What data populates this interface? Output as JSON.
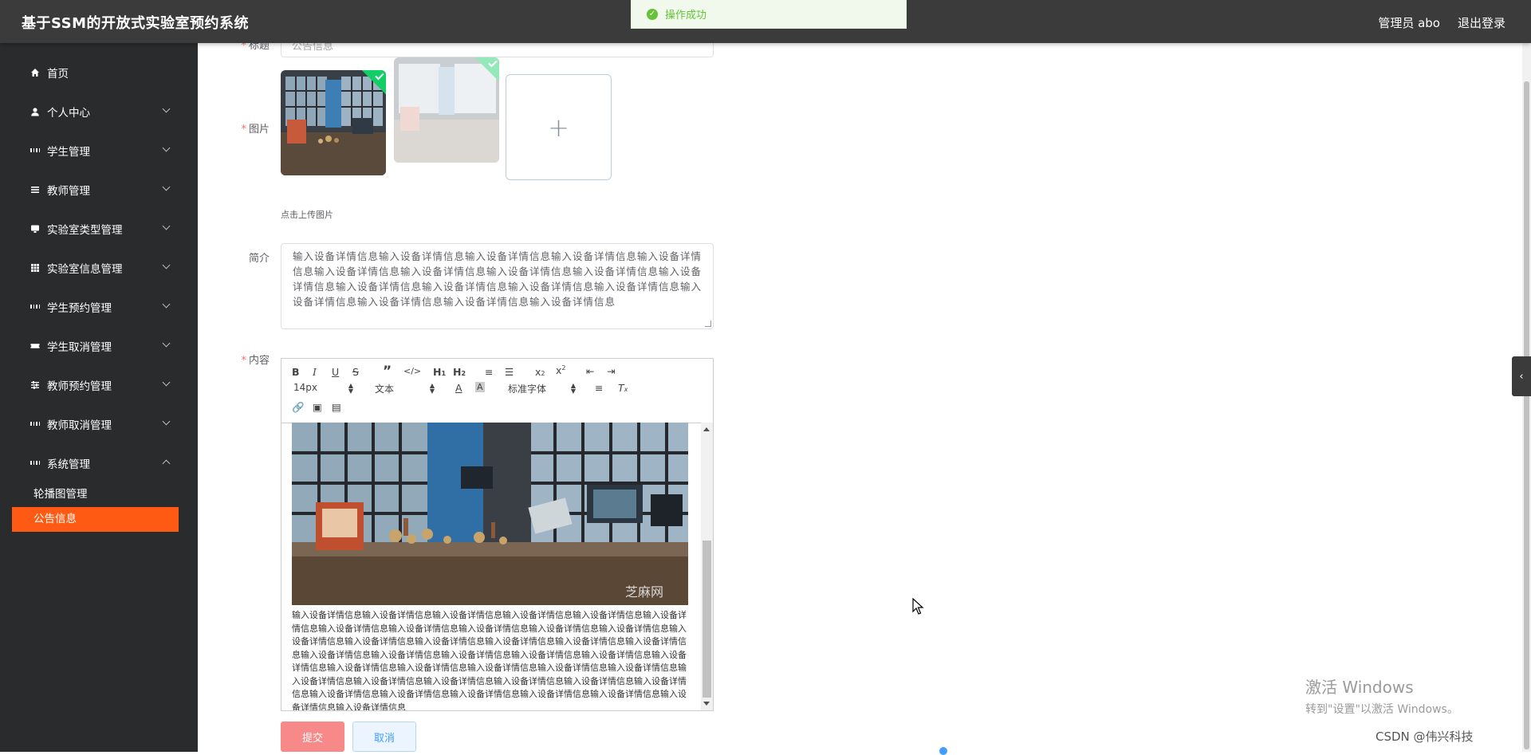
{
  "header": {
    "title": "基于SSM的开放式实验室预约系统",
    "user": "管理员 abo",
    "logout": "退出登录"
  },
  "toast": {
    "message": "操作成功"
  },
  "sidebar": {
    "items": [
      {
        "label": "首页",
        "icon": "home-icon"
      },
      {
        "label": "个人中心",
        "icon": "user-icon"
      },
      {
        "label": "学生管理",
        "icon": "grid-icon"
      },
      {
        "label": "教师管理",
        "icon": "list-icon"
      },
      {
        "label": "实验室类型管理",
        "icon": "monitor-icon"
      },
      {
        "label": "实验室信息管理",
        "icon": "table-icon"
      },
      {
        "label": "学生预约管理",
        "icon": "grid-icon"
      },
      {
        "label": "学生取消管理",
        "icon": "ticket-icon"
      },
      {
        "label": "教师预约管理",
        "icon": "sliders-icon"
      },
      {
        "label": "教师取消管理",
        "icon": "grid-icon"
      },
      {
        "label": "系统管理",
        "icon": "grid-icon"
      }
    ],
    "sub_items": [
      {
        "label": "轮播图管理",
        "active": false
      },
      {
        "label": "公告信息",
        "active": true
      }
    ],
    "active_color": "#ff5a14"
  },
  "form": {
    "title_label": "标题",
    "title_value": "公告信息",
    "image_label": "图片",
    "upload_tip": "点击上传图片",
    "summary_label": "简介",
    "summary_value": "输入设备详情信息输入设备详情信息输入设备详情信息输入设备详情信息输入设备详情信息输入设备详情信息输入设备详情信息输入设备详情信息输入设备详情信息输入设备详情信息输入设备详情信息输入设备详情信息输入设备详情信息输入设备详情信息输入设备详情信息输入设备详情信息输入设备详情信息输入设备详情信息",
    "content_label": "内容",
    "editor": {
      "font_size": "14px",
      "format": "文本",
      "font_family": "标准字体",
      "content_text": "输入设备详情信息输入设备详情信息输入设备详情信息输入设备详情信息输入设备详情信息输入设备详情信息输入设备详情信息输入设备详情信息输入设备详情信息输入设备详情信息输入设备详情信息输入设备详情信息输入设备详情信息输入设备详情信息输入设备详情信息输入设备详情信息输入设备详情信息输入设备详情信息输入设备详情信息输入设备详情信息输入设备详情信息输入设备详情信息输入设备详情信息输入设备详情信息输入设备详情信息输入设备详情信息输入设备详情信息输入设备详情信息输入设备详情信息输入设备详情信息输入设备详情信息输入设备详情信息输入设备详情信息输入设备详情信息输入设备详情信息输入设备详情信息输入设备详情信息输入设备详情信息输入设备详情信息输入设备详情信息输入设备详情信息",
      "image_watermark": "芝麻网"
    },
    "submit": "提交",
    "cancel": "取消"
  },
  "os": {
    "watermark_line1": "激活 Windows",
    "watermark_line2": "转到\"设置\"以激活 Windows。",
    "csdn": "CSDN @伟兴科技"
  }
}
